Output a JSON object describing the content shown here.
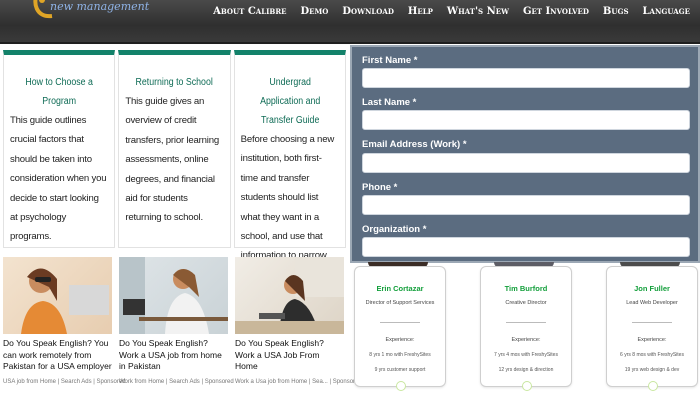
{
  "header": {
    "logo_text": "new management",
    "nav": [
      "About Calibre",
      "Demo",
      "Download",
      "Help",
      "What's New",
      "Get Involved",
      "Bugs",
      "Language"
    ]
  },
  "cards": [
    {
      "title": "How to Choose a Program",
      "body": "This guide outlines crucial factors that should be taken into consideration when you decide to start looking at psychology programs."
    },
    {
      "title": "Returning to School",
      "body": "This guide gives an overview of credit transfers, prior learning assessments, online degrees, and financial aid for students returning to school."
    },
    {
      "title": "Undergrad Application and Transfer Guide",
      "body": "Before choosing a new institution, both first-time and transfer students should list what they want in a school, and use that information to narrow down their top choices."
    }
  ],
  "ads": [
    {
      "title": "Do You Speak English? You can work remotely from Pakistan for a USA employer",
      "meta": "USA job from Home | Search Ads | Sponsored"
    },
    {
      "title": "Do You Speak English? Work a USA job from home in Pakistan",
      "meta": "Work from Home | Search Ads | Sponsored"
    },
    {
      "title": "Do You Speak English? Work a USA Job From Home",
      "meta": "Work a Usa job from Home | Sea... | Sponsored"
    }
  ],
  "form": {
    "fields": [
      {
        "label": "First Name *",
        "value": ""
      },
      {
        "label": "Last Name *",
        "value": ""
      },
      {
        "label": "Email Address (Work) *",
        "value": ""
      },
      {
        "label": "Phone *",
        "value": ""
      },
      {
        "label": "Organization *",
        "value": ""
      }
    ]
  },
  "staff": [
    {
      "name": "Erin Cortazar",
      "role": "Director of Support Services",
      "exp_label": "Experience:",
      "lines": [
        "8 yrs 1 mo with FreshySites",
        "9 yrs customer support"
      ]
    },
    {
      "name": "Tim Burford",
      "role": "Creative Director",
      "exp_label": "Experience:",
      "lines": [
        "7 yrs 4 mos with FreshySites",
        "12 yrs design & direction"
      ]
    },
    {
      "name": "Jon Fuller",
      "role": "Lead Web Developer",
      "exp_label": "Experience:",
      "lines": [
        "6 yrs 8 mos with FreshySites",
        "19 yrs web design & dev"
      ]
    }
  ],
  "colors": {
    "accent": "#13826a",
    "form_bg": "#5b6c80",
    "staff_name": "#139f3b"
  }
}
